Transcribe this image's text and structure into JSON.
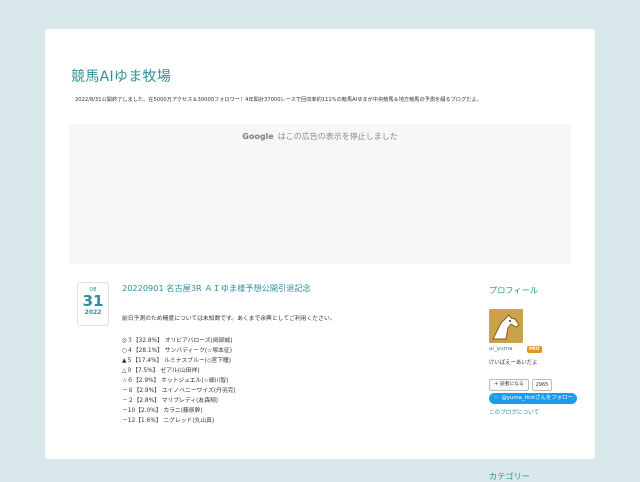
{
  "site": {
    "title": "競馬AIゆま牧場",
    "description": "2022/8/31公開終了しました。在5000万アクセス＆30000フォロワー！4年間計37000レースで回収率約111%の競馬AIゆまが中央競馬＆地方競馬の予測を綴るブログだよ。"
  },
  "ad": {
    "brand": "Google",
    "message": "はこの広告の表示を停止しました"
  },
  "post": {
    "date": {
      "month": "08",
      "day": "31",
      "year": "2022"
    },
    "title": "20220901 名古屋3R ＡＩゆま様予想公開引退記念",
    "intro": "前日予測のため精度については未知数です。あくまで余興としてご利用ください。",
    "entries": [
      "◎３【32.8%】 オリビアバローズ(岡部誠)",
      "○４【28.1%】 サンバディーク(☆塚本征)",
      "▲５【17.4%】 ルミナスブルー(◇宮下瞳)",
      "△９【7.5%】 ゼアル(山田祥)",
      "☆６【2.9%】 ホットジュエル(☆細川智)",
      "－８【2.9%】 ユイノベニーワイズ(丹羽克)",
      "－２【2.8%】 マリブレディ(友森翔)",
      "－10【2.0%】 カラニ(藤原幹)",
      "－12【1.6%】 ニグレッド(丸山真)"
    ]
  },
  "sidebar": {
    "profile_heading": "プロフィール",
    "username": "ai_yuma",
    "pro_badge": "PRO",
    "yomi": "けいばえーあいだよ",
    "reader_button": "読者になる",
    "reader_count": "2965",
    "follow_button": "@yuma_firstさんをフォロー",
    "about_link": "このブログについて",
    "next_heading": "カテゴリー"
  },
  "colors": {
    "background": "#d9e8ea",
    "accent": "#2f8f97",
    "pro": "#d99a1e",
    "twitter": "#1d9bf0"
  }
}
